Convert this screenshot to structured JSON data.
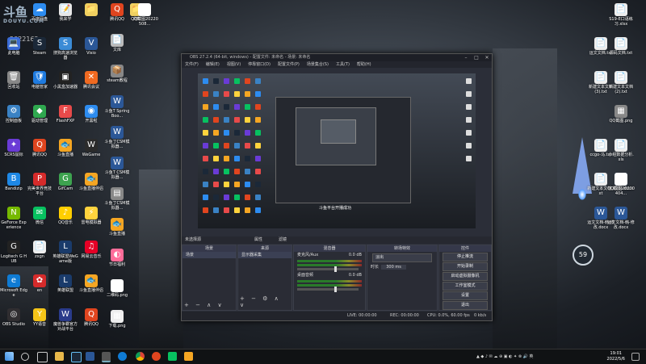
{
  "watermark": {
    "brand": "斗鱼",
    "site": "DOUYU.COM",
    "room": "5022162"
  },
  "desktop_left": [
    {
      "label": "64",
      "color": "#3a6bd6",
      "glyph": "🖥"
    },
    {
      "label": "百度网盘",
      "color": "#2d8cf0",
      "glyph": "☁"
    },
    {
      "label": "我来学",
      "color": "#e8e8e8",
      "glyph": "📝"
    },
    {
      "label": "",
      "color": "#f0d060",
      "glyph": "📁"
    },
    {
      "label": "此电脑",
      "color": "#3a6bd6",
      "glyph": "💻"
    },
    {
      "label": "Steam",
      "color": "#1b2838",
      "glyph": "S"
    },
    {
      "label": "搜狗高速浏览器",
      "color": "#3b8bd6",
      "glyph": "S"
    },
    {
      "label": "Visio",
      "color": "#2b5797",
      "glyph": "V"
    },
    {
      "label": "回收站",
      "color": "#888",
      "glyph": "🗑"
    },
    {
      "label": "电脑管家",
      "color": "#1f7be0",
      "glyph": "🛡"
    },
    {
      "label": "小黑盒加速器",
      "color": "#222",
      "glyph": "▣"
    },
    {
      "label": "腾讯会议",
      "color": "#f06a21",
      "glyph": "✕"
    },
    {
      "label": "控制面板",
      "color": "#3a82c4",
      "glyph": "⚙"
    },
    {
      "label": "驱动管理",
      "color": "#2fa84f",
      "glyph": "◆"
    },
    {
      "label": "FlashFXP",
      "color": "#e84a4a",
      "glyph": "F"
    },
    {
      "label": "开黑啦",
      "color": "#2d8cf0",
      "glyph": "◉"
    },
    {
      "label": "SCRS鼠标",
      "color": "#6a3bd6",
      "glyph": "✦"
    },
    {
      "label": "腾讯QQ",
      "color": "#e0451f",
      "glyph": "Q"
    },
    {
      "label": "斗鱼直播",
      "color": "#f5a623",
      "glyph": "🐟"
    },
    {
      "label": "WeGame",
      "color": "#2b2b2b",
      "glyph": "W"
    },
    {
      "label": "Bandizip",
      "color": "#1e88e5",
      "glyph": "B"
    },
    {
      "label": "完美世界竞技平台",
      "color": "#d62b2b",
      "glyph": "P"
    },
    {
      "label": "GifCam",
      "color": "#3da34f",
      "glyph": "G"
    },
    {
      "label": "斗鱼直播伴侣",
      "color": "#f5a623",
      "glyph": "🐟"
    },
    {
      "label": "GeForce Experience",
      "color": "#76b900",
      "glyph": "N"
    },
    {
      "label": "微信",
      "color": "#07c160",
      "glyph": "✉"
    },
    {
      "label": "QQ音乐",
      "color": "#ffce00",
      "glyph": "♪"
    },
    {
      "label": "雷电模拟器",
      "color": "#ffd33d",
      "glyph": "⚡"
    },
    {
      "label": "Logitech G HUB",
      "color": "#222",
      "glyph": "G"
    },
    {
      "label": "zxgn",
      "color": "#eee",
      "glyph": "📄"
    },
    {
      "label": "英雄联盟WeGame版",
      "color": "#1a3b6b",
      "glyph": "L"
    },
    {
      "label": "网易云音乐",
      "color": "#e60026",
      "glyph": "♫"
    },
    {
      "label": "Microsoft Edge",
      "color": "#0f7bd4",
      "glyph": "e"
    },
    {
      "label": "en",
      "color": "#d62b2b",
      "glyph": "✿"
    },
    {
      "label": "英雄联盟",
      "color": "#1a3b6b",
      "glyph": "L"
    },
    {
      "label": "斗鱼直播伴侣",
      "color": "#f5a623",
      "glyph": "🐟"
    },
    {
      "label": "OBS Studio",
      "color": "#302e31",
      "glyph": "◎"
    },
    {
      "label": "YY语音",
      "color": "#f5c518",
      "glyph": "Y"
    },
    {
      "label": "魔兽争霸官方对战平台",
      "color": "#2a3b8b",
      "glyph": "W"
    },
    {
      "label": "腾讯QQ",
      "color": "#e0451f",
      "glyph": "Q"
    }
  ],
  "desktop_col5": [
    {
      "label": "腾讯QQ",
      "color": "#e0451f",
      "glyph": "Q"
    },
    {
      "label": "文库",
      "color": "#bbb",
      "glyph": "📄"
    },
    {
      "label": "steam教程",
      "color": "#888",
      "glyph": "📦"
    },
    {
      "label": "斗鱼T SpringBoo...",
      "color": "#2b5797",
      "glyph": "W"
    },
    {
      "label": "斗鱼丁CSM模拟器...",
      "color": "#2b5797",
      "glyph": "W"
    },
    {
      "label": "斗鱼T CSM模拟器...",
      "color": "#2b5797",
      "glyph": "W"
    },
    {
      "label": "斗鱼丁CSM模拟器...",
      "color": "#888",
      "glyph": "▤"
    },
    {
      "label": "斗鱼直播",
      "color": "#f5a623",
      "glyph": "🐟"
    },
    {
      "label": "节日福利",
      "color": "#ff6d9a",
      "glyph": "◐"
    },
    {
      "label": "二维码.png",
      "color": "#fff",
      "glyph": "▦"
    },
    {
      "label": "下载.png",
      "color": "#eee",
      "glyph": "▦"
    }
  ],
  "desktop_col6": [
    {
      "label": "学",
      "color": "#eee",
      "glyph": "📄"
    },
    {
      "label": "文库",
      "color": "#f0d060",
      "glyph": "📁"
    },
    {
      "label": "QQ截图20220508...",
      "color": "#fff",
      "glyph": "▦"
    }
  ],
  "desktop_right": [
    {
      "label": "S19-E口语练习.xlsx",
      "color": "#eee",
      "glyph": "📄"
    },
    {
      "label": "运文文档.txt",
      "color": "#eee",
      "glyph": "📄"
    },
    {
      "label": "源码文档.txt",
      "color": "#eee",
      "glyph": "📄"
    },
    {
      "label": "新建文本文档(3).txt",
      "color": "#eee",
      "glyph": "📄"
    },
    {
      "label": "新建文本文档(2).txt",
      "color": "#eee",
      "glyph": "📄"
    },
    {
      "label": "QQ截图.png",
      "color": "#888",
      "glyph": "▦"
    },
    {
      "label": "小组数据分析.xls",
      "color": "#eee",
      "glyph": "📄"
    },
    {
      "label": "ccgo-马.txt",
      "color": "#eee",
      "glyph": "📄"
    },
    {
      "label": "立题(3).docx",
      "color": "#2b5797",
      "glyph": "W"
    },
    {
      "label": "新建文本文档.txt",
      "color": "#eee",
      "glyph": "📄"
    },
    {
      "label": "QQ截图20220404...",
      "color": "#fff",
      "glyph": "▦"
    },
    {
      "label": "运文文档-韩-修改.docx",
      "color": "#2b5797",
      "glyph": "W"
    },
    {
      "label": "运文文档-韩-修改.docx",
      "color": "#2b5797",
      "glyph": "W"
    }
  ],
  "obs": {
    "title": "OBS 27.2.4 (64-bit, windows) - 配置文件: 未命名 - 场景: 未命名",
    "menus": [
      "文件(F)",
      "编辑(E)",
      "视图(V)",
      "停靠窗口(D)",
      "配置文件(P)",
      "场景集合(S)",
      "工具(T)",
      "帮助(H)"
    ],
    "preview_text": "斗鱼平台开播成功",
    "source_bar": {
      "left": "未选择源",
      "mid": "属性",
      "right": "滤镜"
    },
    "scenes": {
      "title": "场景",
      "items": [
        "场景"
      ]
    },
    "sources": {
      "title": "来源",
      "items": [
        "显示器采集"
      ]
    },
    "mixer": {
      "title": "混音器",
      "tracks": [
        {
          "name": "麦克风/Aux",
          "db": "0.0 dB",
          "level": 0.82
        },
        {
          "name": "桌面音频",
          "db": "0.0 dB",
          "level": 0.82
        }
      ]
    },
    "transitions": {
      "title": "转场特效",
      "type": "淡出",
      "duration_label": "时长",
      "duration": "300 ms"
    },
    "controls": {
      "title": "控件",
      "buttons": [
        "停止推流",
        "开始录制",
        "启动虚拟摄像机",
        "工作室模式",
        "设置",
        "退出"
      ]
    },
    "status": {
      "live": "LIVE: 00:00:00",
      "rec": "REC: 00:00:00",
      "cpu": "CPU: 0.0%, 60.00 fps",
      "net": "0 kb/s"
    }
  },
  "taskbar": {
    "time": "19:01",
    "date": "2022/5/6",
    "badge": "59"
  }
}
